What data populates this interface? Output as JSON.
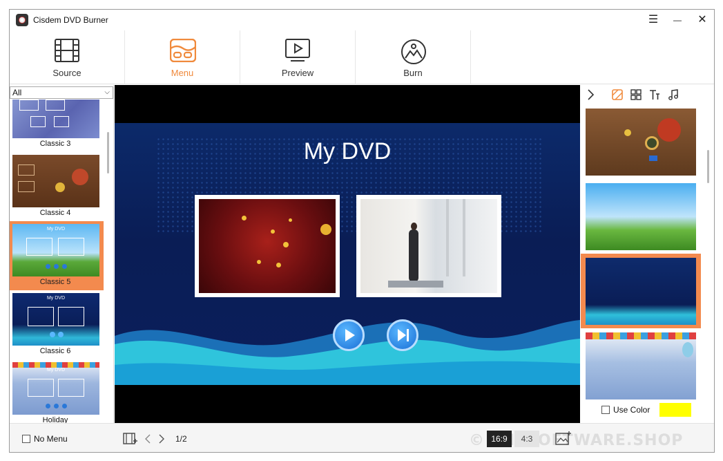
{
  "app": {
    "title": "Cisdem DVD Burner"
  },
  "window_controls": {
    "menu": "☰",
    "minimize": "—",
    "close": "✕"
  },
  "nav": {
    "tabs": [
      {
        "label": "Source"
      },
      {
        "label": "Menu",
        "active": true
      },
      {
        "label": "Preview"
      },
      {
        "label": "Burn"
      }
    ]
  },
  "templates": {
    "filter": "All",
    "items": [
      {
        "label": "Classic 3",
        "thumb_text": ""
      },
      {
        "label": "Classic 4",
        "thumb_text": ""
      },
      {
        "label": "Classic 5",
        "thumb_text": "My DVD",
        "selected": true
      },
      {
        "label": "Classic 6",
        "thumb_text": "My DVD"
      },
      {
        "label": "Holiday",
        "thumb_text": "My DVD"
      }
    ]
  },
  "preview": {
    "title": "My DVD"
  },
  "right_panel": {
    "tabs": [
      "background-icon",
      "layout-icon",
      "text-icon",
      "music-icon"
    ],
    "use_color_label": "Use Color",
    "color": "#ffff00"
  },
  "bottom": {
    "no_menu_label": "No Menu",
    "page": "1/2",
    "ratio_169": "16:9",
    "ratio_43": "4:3",
    "watermark": "© THESOFTWARE.SHOP"
  },
  "colors": {
    "accent": "#f08a3c",
    "selection": "#f38a4e"
  }
}
